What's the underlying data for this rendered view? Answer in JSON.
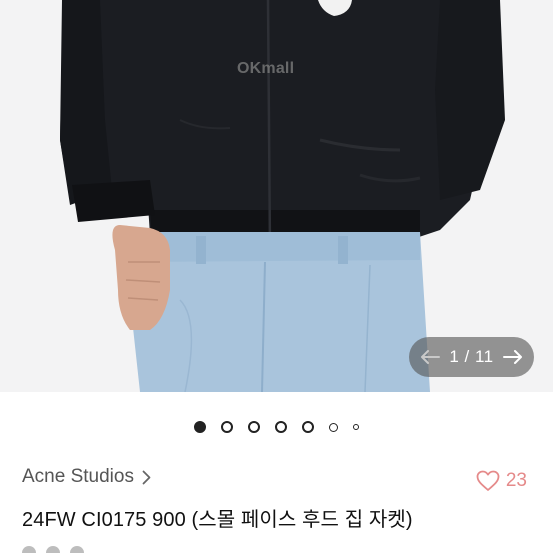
{
  "gallery": {
    "watermark": "OKmall",
    "counter": "1 / 11",
    "prev_icon": "arrow-left-icon",
    "next_icon": "arrow-right-icon",
    "current_slide": 1,
    "total_slides": 11,
    "visible_dots": 7
  },
  "product": {
    "brand": "Acne Studios",
    "brand_chevron_icon": "chevron-right-icon",
    "title": "24FW   CI0175 900 (스몰 페이스 후드 집 자켓)",
    "like_count": "23",
    "like_icon": "heart-outline-icon"
  },
  "colors": {
    "accent_like": "#e58a8a",
    "brand_text": "#555555",
    "title_text": "#111111",
    "pager_bg": "#555555"
  }
}
